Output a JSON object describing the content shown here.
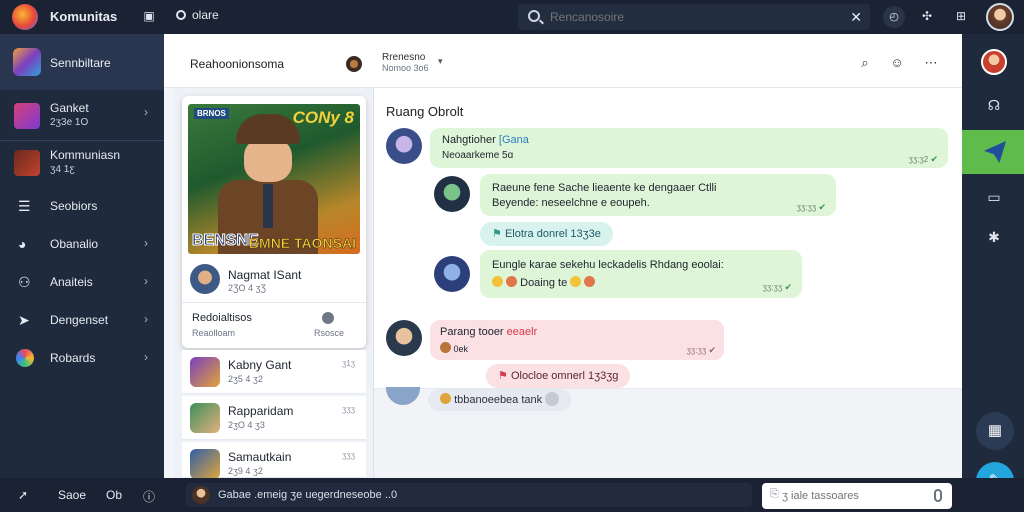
{
  "app": {
    "title": "Komunitas",
    "top_link": "olare",
    "search_placeholder": "Rencanosoire",
    "icons": [
      "grid-icon",
      "circle-icon",
      "history-icon",
      "share-icon",
      "gift-icon",
      "user-avatar"
    ]
  },
  "sidebar": {
    "header_label": "Sennbiltare",
    "items": [
      {
        "label": "Ganket",
        "sub": "2ʒ3e 1O"
      },
      {
        "label": "Kommuniasn",
        "sub": "ʒ4 1ƹ"
      },
      {
        "label": "Seobiors",
        "sub": ""
      },
      {
        "label": "Obanalio",
        "sub": ""
      },
      {
        "label": "Anaiteis",
        "sub": ""
      },
      {
        "label": "Dengenset",
        "sub": ""
      },
      {
        "label": "Robards",
        "sub": ""
      }
    ]
  },
  "main_header": {
    "title": "Reahoonionsoma",
    "badge": "ƷG",
    "sub1": "Rrenesno",
    "sub2": "Nomoo 3o6"
  },
  "game_card": {
    "art_top_right": "CONy 8",
    "art_top_left": "BRNOS",
    "art_bottom_left": "BENSNE",
    "art_bottom_right": "BMNE TAONSAI",
    "player_name": "Nagmat ISant",
    "player_meta": "2ƷO 4 ʒƷ",
    "footer_title": "Redoialtisos",
    "footer_sub": "Reaolloam",
    "footer_right": "Rsosce"
  },
  "list_items": [
    {
      "name": "Kabny Gant",
      "meta": "2ʒ5 4 ʒ2",
      "time": "ʒ1ʒ"
    },
    {
      "name": "Rapparidam",
      "meta": "2ʒO 4 ʒ3",
      "time": "ʒʒʒ"
    },
    {
      "name": "Samautkain",
      "meta": "2ʒ9 4 ʒ2",
      "time": "ʒʒʒ"
    }
  ],
  "chat": {
    "title": "Ruang Obrolt",
    "messages": [
      {
        "name": "Nahgtioher",
        "tag": "[Gana",
        "text": "Neoaarkeme 5ɑ",
        "time": "ʒʒ:ʒ2"
      },
      {
        "text1": "Raeune fene Sache lieaente ke dengaaer Ctlli",
        "text2": "Beyende: neseelchne e eoupeh.",
        "time": "ʒʒ:ʒʒ"
      },
      {
        "pill": "Elotra donrel 13ʒ3e"
      },
      {
        "text1": "Eungle karae sekehu leckadelis Rhdang eoolai:",
        "text2": "Doaing te",
        "time": "ʒʒ:ʒʒ"
      },
      {
        "name": "Parang tooer",
        "tag": "eeaelr",
        "text": "0ek",
        "time": "ʒʒ:ʒʒ"
      },
      {
        "pill": "Olocloe omnerl 1ʒ3ʒg"
      },
      {
        "text": "tbbanoeebea tank"
      }
    ]
  },
  "bottom_bar": {
    "left1": "Saoe",
    "left2": "Ob",
    "composer_text": "Gabae .emeig ʒe uegerdneseobe ..0",
    "reply_placeholder": "ʒ iale tassoares"
  },
  "colors": {
    "accent_green": "#5fbb4b",
    "bubble_green": "#dff5d7",
    "bubble_pink": "#fbe0e4",
    "pill_teal": "#d8f2ee",
    "dark_bg": "#1f2a3c"
  }
}
